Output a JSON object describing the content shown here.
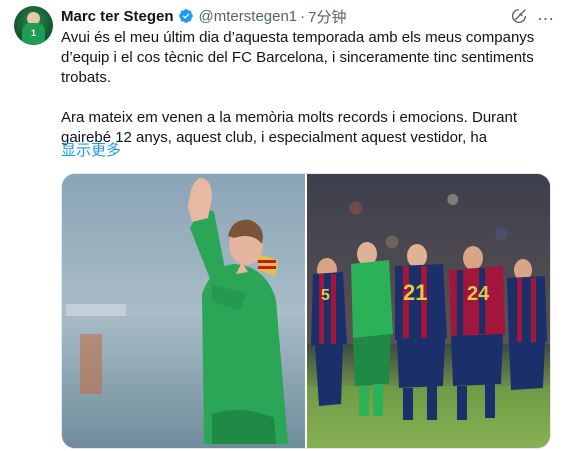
{
  "tweet": {
    "author_name": "Marc ter Stegen",
    "author_handle": "@mterstegen1",
    "separator": "·",
    "time": "7分钟",
    "avatar_number": "1",
    "paragraphs": [
      "Avui és el meu últim dia d’aquesta temporada amb els meus companys d’equip i el cos tècnic del FC Barcelona, i sinceramente tinc sentiments trobats.",
      "Ara mateix em venen a la memòria molts records i emocions. Durant gairebé 12 anys, aquest club, i especialment aquest vestidor, ha"
    ],
    "show_more": "显示更多",
    "more_icon": "…",
    "icons": {
      "verified": "verified-badge-icon",
      "grok": "grok-icon",
      "more": "more-options-icon"
    },
    "media": {
      "photo_left_numbers": [],
      "photo_right_numbers": [
        "5",
        "21",
        "24"
      ]
    },
    "colors": {
      "link": "#1d9bf0",
      "secondary_text": "#536471",
      "keeper_green": "#2bb259",
      "barca_blue": "#1b2f6b",
      "barca_red": "#a3163c"
    }
  }
}
